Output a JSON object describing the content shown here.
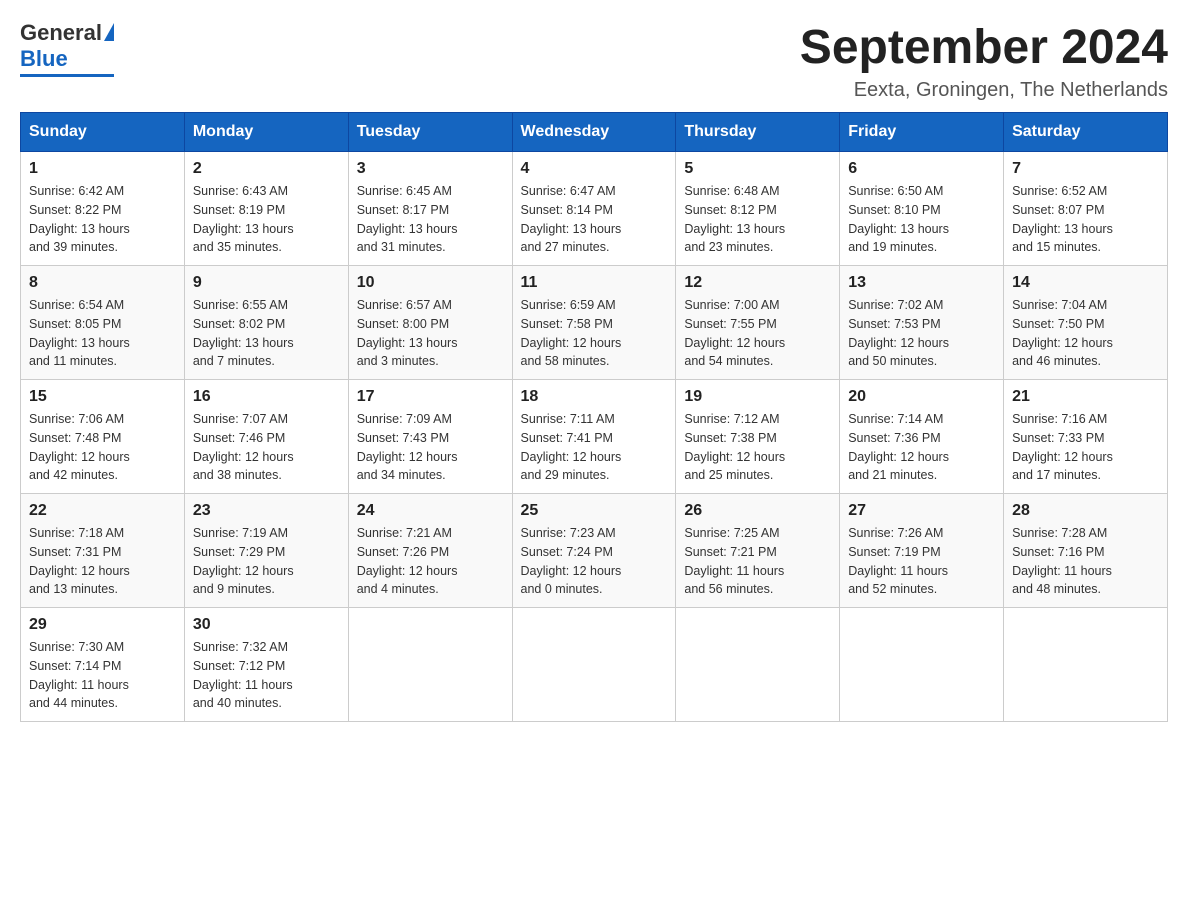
{
  "header": {
    "logo_general": "General",
    "logo_blue": "Blue",
    "month_title": "September 2024",
    "location": "Eexta, Groningen, The Netherlands"
  },
  "days_of_week": [
    "Sunday",
    "Monday",
    "Tuesday",
    "Wednesday",
    "Thursday",
    "Friday",
    "Saturday"
  ],
  "weeks": [
    [
      {
        "day": "1",
        "sunrise": "6:42 AM",
        "sunset": "8:22 PM",
        "daylight": "13 hours and 39 minutes."
      },
      {
        "day": "2",
        "sunrise": "6:43 AM",
        "sunset": "8:19 PM",
        "daylight": "13 hours and 35 minutes."
      },
      {
        "day": "3",
        "sunrise": "6:45 AM",
        "sunset": "8:17 PM",
        "daylight": "13 hours and 31 minutes."
      },
      {
        "day": "4",
        "sunrise": "6:47 AM",
        "sunset": "8:14 PM",
        "daylight": "13 hours and 27 minutes."
      },
      {
        "day": "5",
        "sunrise": "6:48 AM",
        "sunset": "8:12 PM",
        "daylight": "13 hours and 23 minutes."
      },
      {
        "day": "6",
        "sunrise": "6:50 AM",
        "sunset": "8:10 PM",
        "daylight": "13 hours and 19 minutes."
      },
      {
        "day": "7",
        "sunrise": "6:52 AM",
        "sunset": "8:07 PM",
        "daylight": "13 hours and 15 minutes."
      }
    ],
    [
      {
        "day": "8",
        "sunrise": "6:54 AM",
        "sunset": "8:05 PM",
        "daylight": "13 hours and 11 minutes."
      },
      {
        "day": "9",
        "sunrise": "6:55 AM",
        "sunset": "8:02 PM",
        "daylight": "13 hours and 7 minutes."
      },
      {
        "day": "10",
        "sunrise": "6:57 AM",
        "sunset": "8:00 PM",
        "daylight": "13 hours and 3 minutes."
      },
      {
        "day": "11",
        "sunrise": "6:59 AM",
        "sunset": "7:58 PM",
        "daylight": "12 hours and 58 minutes."
      },
      {
        "day": "12",
        "sunrise": "7:00 AM",
        "sunset": "7:55 PM",
        "daylight": "12 hours and 54 minutes."
      },
      {
        "day": "13",
        "sunrise": "7:02 AM",
        "sunset": "7:53 PM",
        "daylight": "12 hours and 50 minutes."
      },
      {
        "day": "14",
        "sunrise": "7:04 AM",
        "sunset": "7:50 PM",
        "daylight": "12 hours and 46 minutes."
      }
    ],
    [
      {
        "day": "15",
        "sunrise": "7:06 AM",
        "sunset": "7:48 PM",
        "daylight": "12 hours and 42 minutes."
      },
      {
        "day": "16",
        "sunrise": "7:07 AM",
        "sunset": "7:46 PM",
        "daylight": "12 hours and 38 minutes."
      },
      {
        "day": "17",
        "sunrise": "7:09 AM",
        "sunset": "7:43 PM",
        "daylight": "12 hours and 34 minutes."
      },
      {
        "day": "18",
        "sunrise": "7:11 AM",
        "sunset": "7:41 PM",
        "daylight": "12 hours and 29 minutes."
      },
      {
        "day": "19",
        "sunrise": "7:12 AM",
        "sunset": "7:38 PM",
        "daylight": "12 hours and 25 minutes."
      },
      {
        "day": "20",
        "sunrise": "7:14 AM",
        "sunset": "7:36 PM",
        "daylight": "12 hours and 21 minutes."
      },
      {
        "day": "21",
        "sunrise": "7:16 AM",
        "sunset": "7:33 PM",
        "daylight": "12 hours and 17 minutes."
      }
    ],
    [
      {
        "day": "22",
        "sunrise": "7:18 AM",
        "sunset": "7:31 PM",
        "daylight": "12 hours and 13 minutes."
      },
      {
        "day": "23",
        "sunrise": "7:19 AM",
        "sunset": "7:29 PM",
        "daylight": "12 hours and 9 minutes."
      },
      {
        "day": "24",
        "sunrise": "7:21 AM",
        "sunset": "7:26 PM",
        "daylight": "12 hours and 4 minutes."
      },
      {
        "day": "25",
        "sunrise": "7:23 AM",
        "sunset": "7:24 PM",
        "daylight": "12 hours and 0 minutes."
      },
      {
        "day": "26",
        "sunrise": "7:25 AM",
        "sunset": "7:21 PM",
        "daylight": "11 hours and 56 minutes."
      },
      {
        "day": "27",
        "sunrise": "7:26 AM",
        "sunset": "7:19 PM",
        "daylight": "11 hours and 52 minutes."
      },
      {
        "day": "28",
        "sunrise": "7:28 AM",
        "sunset": "7:16 PM",
        "daylight": "11 hours and 48 minutes."
      }
    ],
    [
      {
        "day": "29",
        "sunrise": "7:30 AM",
        "sunset": "7:14 PM",
        "daylight": "11 hours and 44 minutes."
      },
      {
        "day": "30",
        "sunrise": "7:32 AM",
        "sunset": "7:12 PM",
        "daylight": "11 hours and 40 minutes."
      },
      null,
      null,
      null,
      null,
      null
    ]
  ],
  "labels": {
    "sunrise": "Sunrise:",
    "sunset": "Sunset:",
    "daylight": "Daylight:"
  }
}
